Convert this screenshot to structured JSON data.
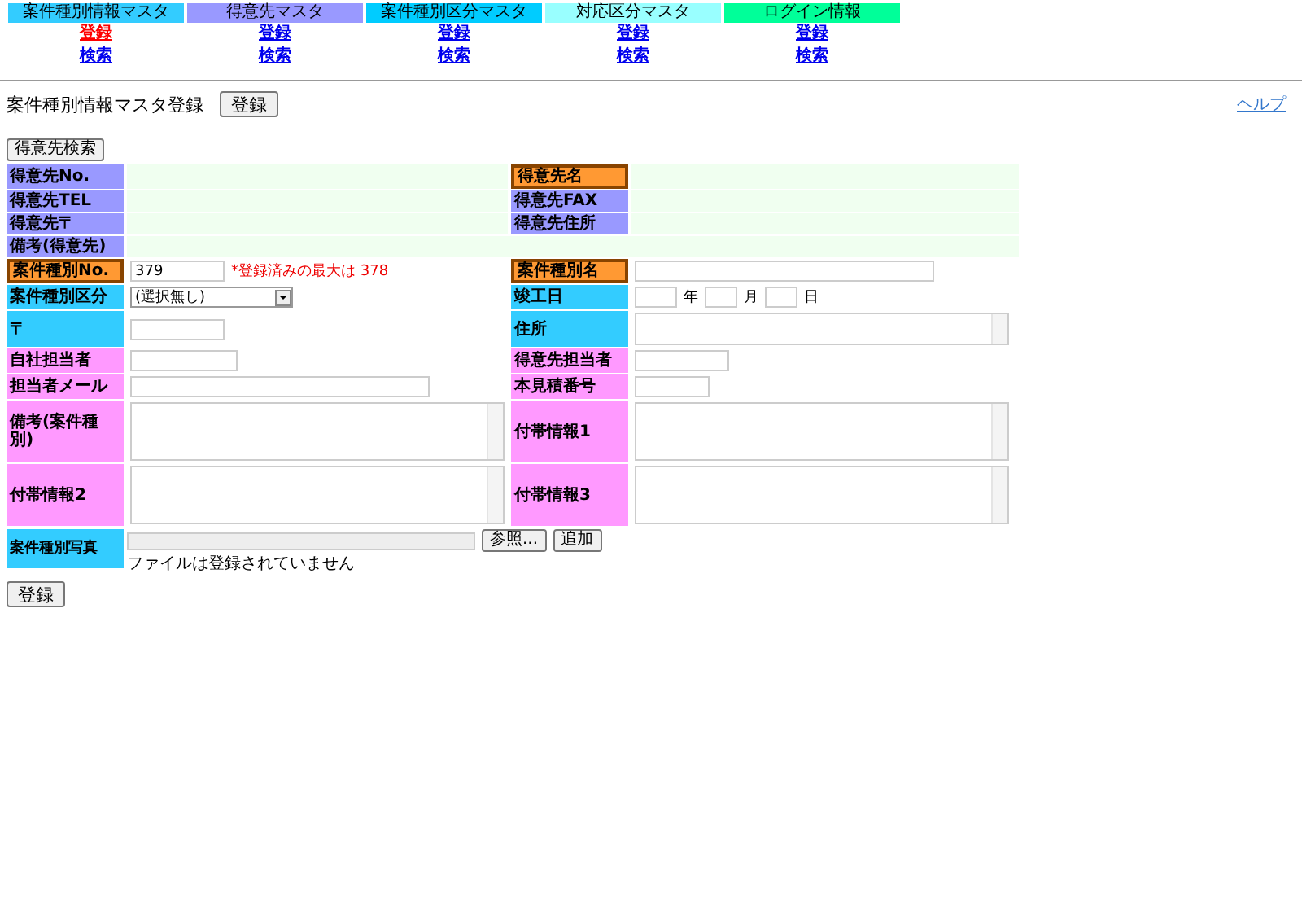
{
  "nav": [
    {
      "title": "案件種別情報マスタ",
      "color": "#33ccff",
      "links": [
        {
          "label": "登録",
          "selected": true
        },
        {
          "label": "検索",
          "selected": false
        }
      ]
    },
    {
      "title": "得意先マスタ",
      "color": "#9999ff",
      "links": [
        {
          "label": "登録",
          "selected": false
        },
        {
          "label": "検索",
          "selected": false
        }
      ]
    },
    {
      "title": "案件種別区分マスタ",
      "color": "#00ccff",
      "links": [
        {
          "label": "登録",
          "selected": false
        },
        {
          "label": "検索",
          "selected": false
        }
      ]
    },
    {
      "title": "対応区分マスタ",
      "color": "#99ffff",
      "links": [
        {
          "label": "登録",
          "selected": false
        },
        {
          "label": "検索",
          "selected": false
        }
      ]
    },
    {
      "title": "ログイン情報",
      "color": "#00ff99",
      "links": [
        {
          "label": "登録",
          "selected": false
        },
        {
          "label": "検索",
          "selected": false
        }
      ]
    }
  ],
  "page_title": "案件種別情報マスタ登録",
  "register_button": "登録",
  "help_link": "ヘルプ",
  "customer_search_button": "得意先検索",
  "form_rows": [
    {
      "cells": [
        {
          "label": {
            "text": "得意先No.",
            "color": "#9999ff",
            "required": false
          },
          "field": {
            "kind": "display"
          }
        },
        {
          "label": {
            "text": "得意先名",
            "color": "#ff9933",
            "required": true
          },
          "field": {
            "kind": "display"
          }
        }
      ]
    },
    {
      "cells": [
        {
          "label": {
            "text": "得意先TEL",
            "color": "#9999ff",
            "required": false
          },
          "field": {
            "kind": "display"
          }
        },
        {
          "label": {
            "text": "得意先FAX",
            "color": "#9999ff",
            "required": false
          },
          "field": {
            "kind": "display"
          }
        }
      ]
    },
    {
      "cells": [
        {
          "label": {
            "text": "得意先〒",
            "color": "#9999ff",
            "required": false
          },
          "field": {
            "kind": "display"
          }
        },
        {
          "label": {
            "text": "得意先住所",
            "color": "#9999ff",
            "required": false
          },
          "field": {
            "kind": "display"
          }
        }
      ]
    },
    {
      "cells": [
        {
          "label": {
            "text": "備考(得意先)",
            "color": "#9999ff",
            "required": false
          },
          "field": {
            "kind": "display"
          }
        }
      ]
    },
    {
      "cells": [
        {
          "label": {
            "text": "案件種別No.",
            "color": "#ff9933",
            "required": true
          },
          "field": {
            "kind": "short",
            "value": "379",
            "note": "*登録済みの最大は 378"
          }
        },
        {
          "label": {
            "text": "案件種別名",
            "color": "#ff9933",
            "required": true
          },
          "field": {
            "kind": "long"
          }
        }
      ]
    },
    {
      "cells": [
        {
          "label": {
            "text": "案件種別区分",
            "color": "#33ccff",
            "required": false
          },
          "field": {
            "kind": "select",
            "value": "(選択無し)"
          }
        },
        {
          "label": {
            "text": "竣工日",
            "color": "#33ccff",
            "required": false
          },
          "field": {
            "kind": "date",
            "units": [
              "年",
              "月",
              "日"
            ]
          }
        }
      ]
    },
    {
      "cells": [
        {
          "label": {
            "text": "〒",
            "color": "#33ccff",
            "required": false
          },
          "field": {
            "kind": "short"
          }
        },
        {
          "label": {
            "text": "住所",
            "color": "#33ccff",
            "required": false
          },
          "field": {
            "kind": "textarea_small"
          }
        }
      ]
    },
    {
      "cells": [
        {
          "label": {
            "text": "自社担当者",
            "color": "#ff99ff",
            "required": false
          },
          "field": {
            "kind": "short"
          }
        },
        {
          "label": {
            "text": "得意先担当者",
            "color": "#ff99ff",
            "required": false
          },
          "field": {
            "kind": "short"
          }
        }
      ]
    },
    {
      "cells": [
        {
          "label": {
            "text": "担当者メール",
            "color": "#ff99ff",
            "required": false
          },
          "field": {
            "kind": "long"
          }
        },
        {
          "label": {
            "text": "本見積番号",
            "color": "#ff99ff",
            "required": false
          },
          "field": {
            "kind": "tiny"
          }
        }
      ]
    },
    {
      "cells": [
        {
          "label": {
            "text": "備考(案件種別)",
            "color": "#ff99ff",
            "required": false
          },
          "field": {
            "kind": "textarea"
          }
        },
        {
          "label": {
            "text": "付帯情報1",
            "color": "#ff99ff",
            "required": false
          },
          "field": {
            "kind": "textarea"
          }
        }
      ]
    },
    {
      "cells": [
        {
          "label": {
            "text": "付帯情報2",
            "color": "#ff99ff",
            "required": false
          },
          "field": {
            "kind": "textarea"
          }
        },
        {
          "label": {
            "text": "付帯情報3",
            "color": "#ff99ff",
            "required": false
          },
          "field": {
            "kind": "textarea"
          }
        }
      ]
    }
  ],
  "photo": {
    "label": "案件種別写真",
    "browse_button": "参照...",
    "add_button": "追加",
    "status": "ファイルは登録されていません"
  },
  "bottom_button": "登録"
}
